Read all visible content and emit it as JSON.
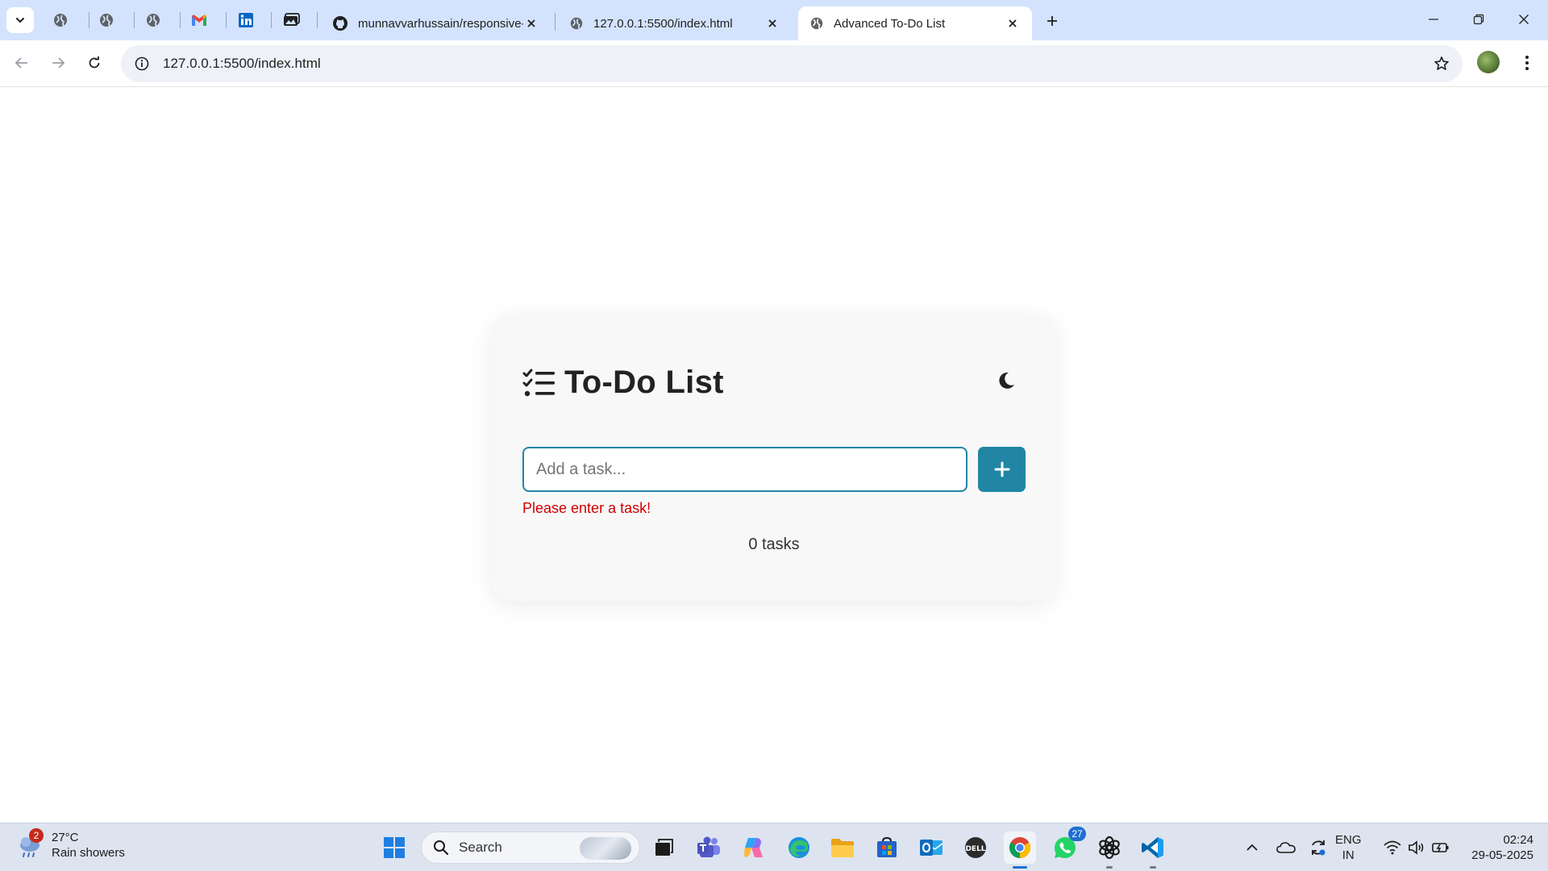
{
  "browser": {
    "tabs": [
      {
        "title": "munnavvarhussain/responsive-",
        "icon": "github-icon"
      },
      {
        "title": "127.0.0.1:5500/index.html",
        "icon": "globe-icon"
      },
      {
        "title": "Advanced To-Do List",
        "icon": "globe-icon",
        "active": true
      }
    ],
    "pinned_tabs": [
      "globe-icon",
      "globe-icon",
      "globe-icon",
      "gmail-icon",
      "linkedin-icon",
      "photos-icon"
    ],
    "url": "127.0.0.1:5500/index.html"
  },
  "app": {
    "title": "To-Do List",
    "input_placeholder": "Add a task...",
    "input_value": "",
    "add_button_symbol": "+",
    "error": "Please enter a task!",
    "task_count": "0 tasks",
    "theme_toggle_icon": "moon-icon",
    "accent_color": "#2186a3",
    "error_color": "#d00000"
  },
  "taskbar": {
    "weather": {
      "temp": "27°C",
      "condition": "Rain showers",
      "badge": "2"
    },
    "search_label": "Search",
    "whatsapp_badge": "27",
    "language": {
      "line1": "ENG",
      "line2": "IN"
    },
    "clock": {
      "time": "02:24",
      "date": "29-05-2025"
    }
  }
}
